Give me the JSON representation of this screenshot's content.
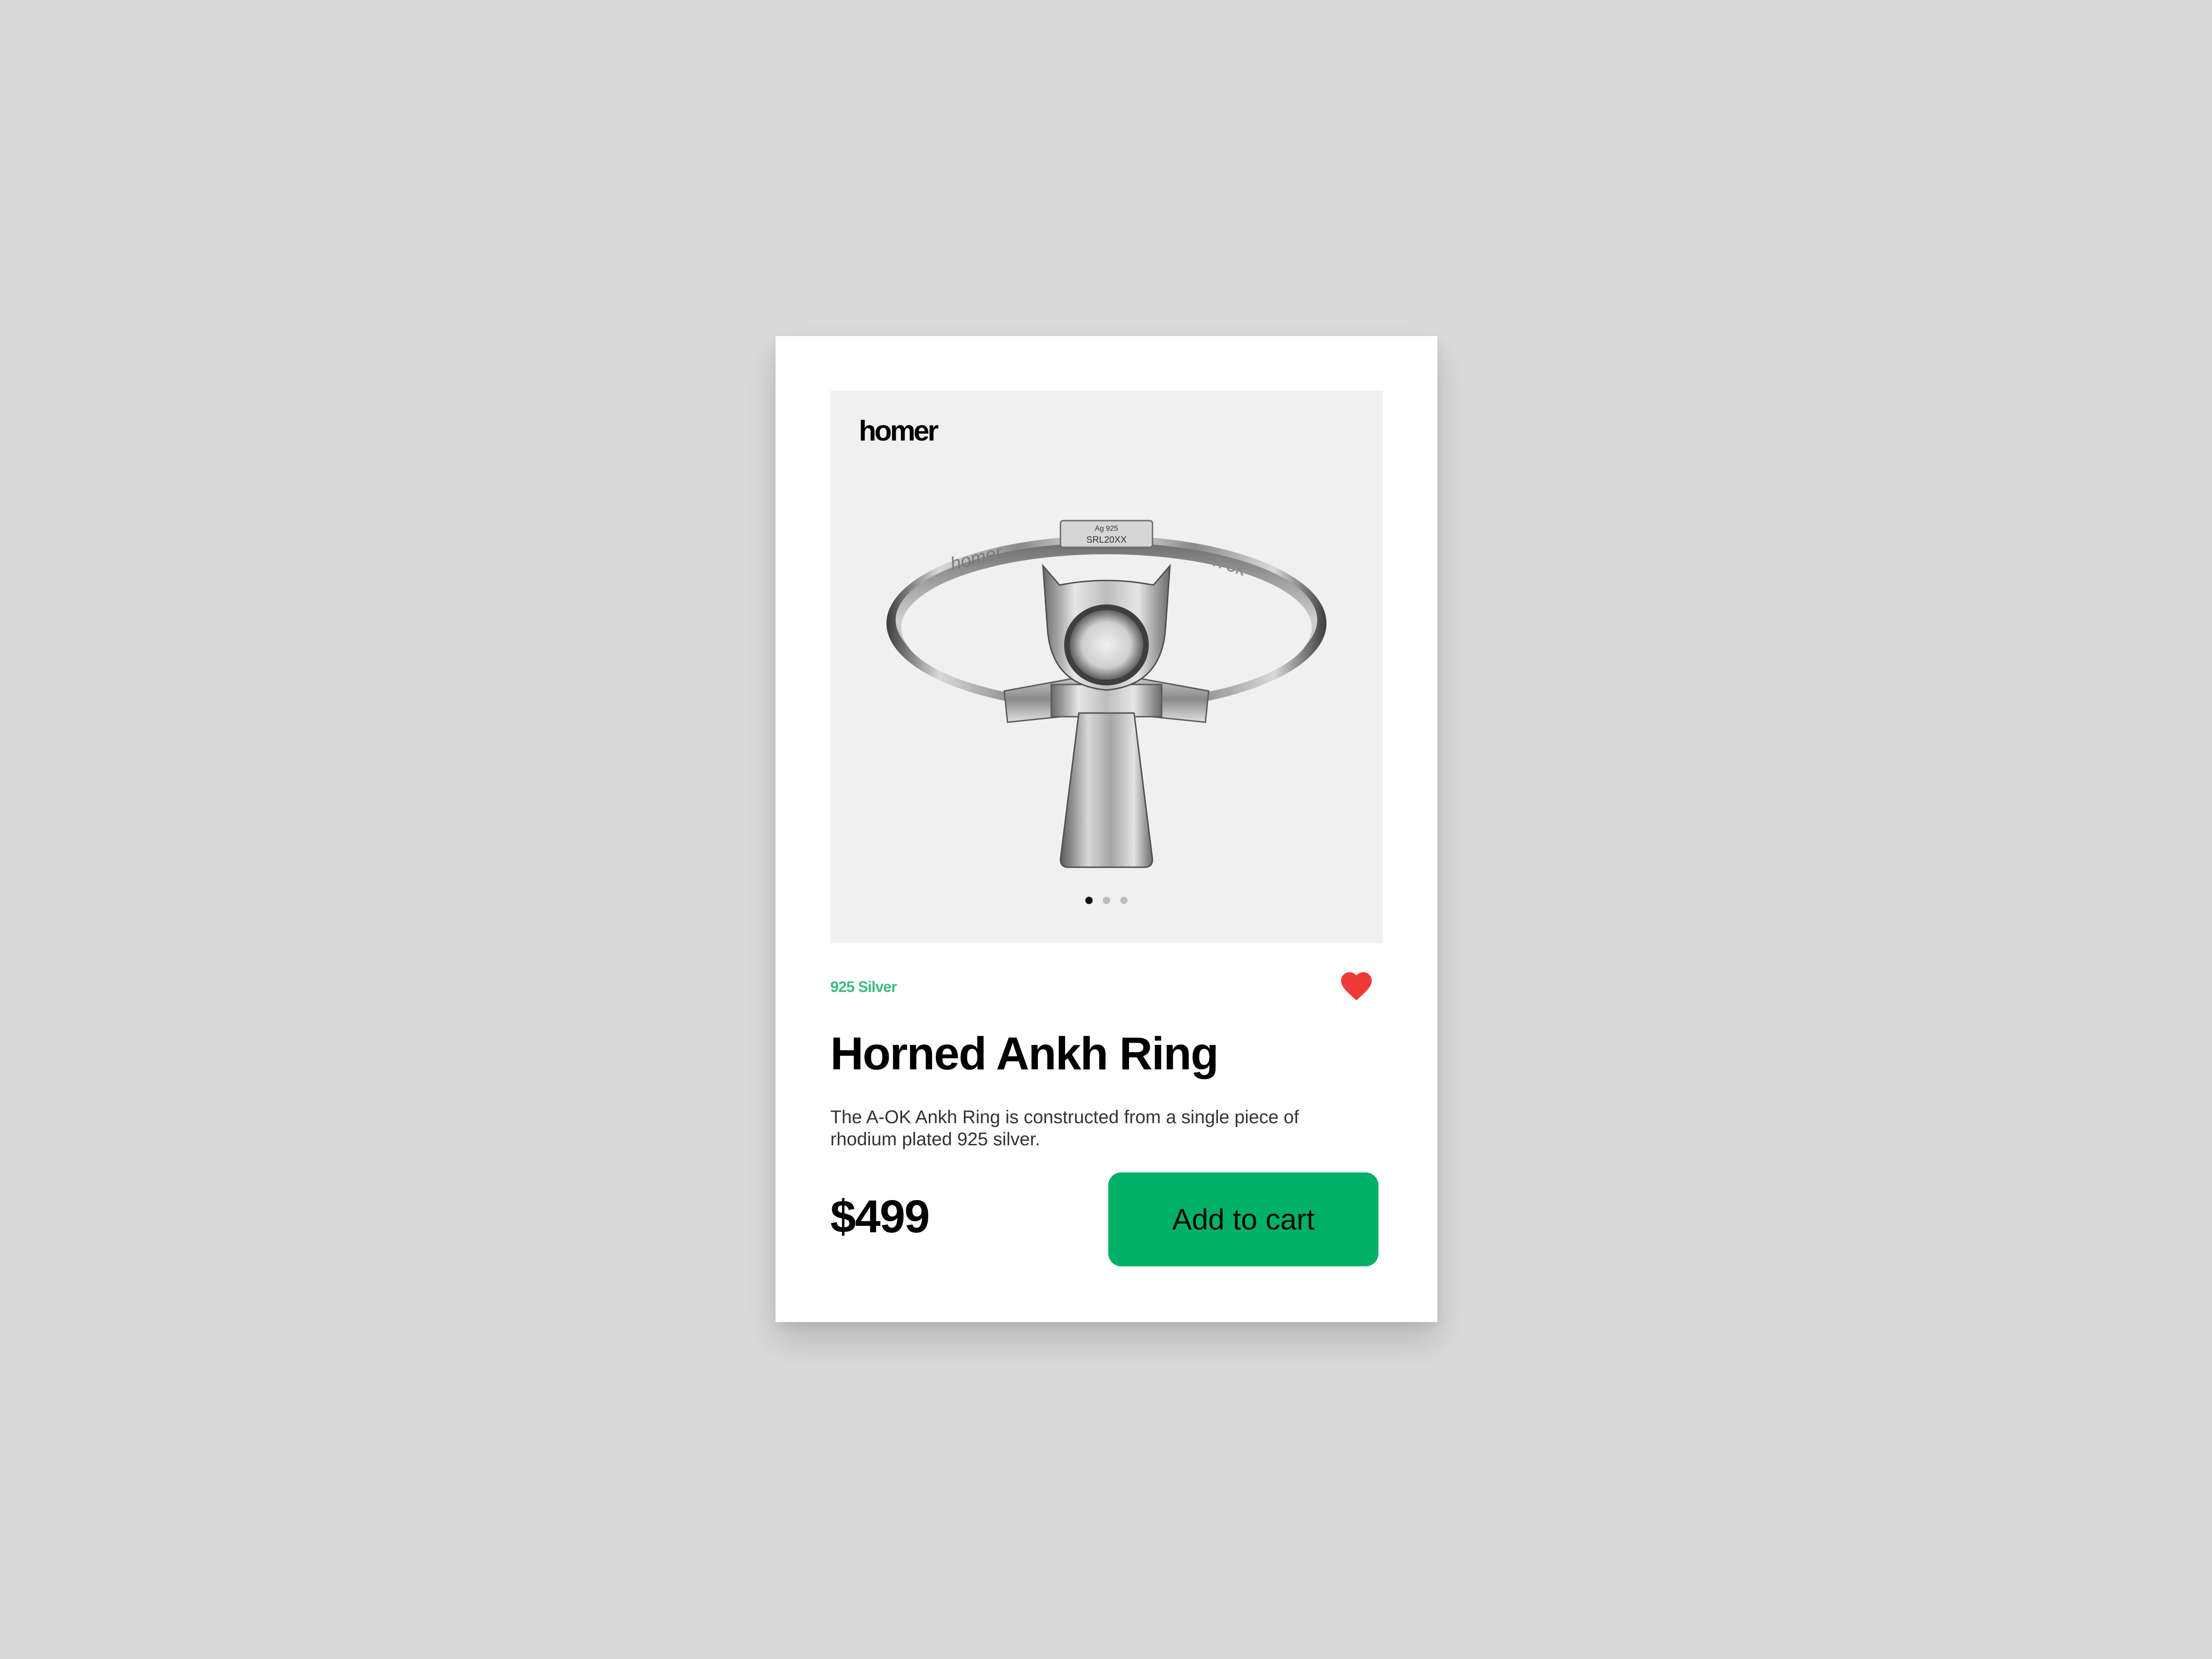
{
  "product": {
    "brand": "homer",
    "material": "925 Silver",
    "title": "Horned Ankh Ring",
    "description": "The A-OK Ankh Ring is constructed from a single piece of rhodium plated 925 silver.",
    "price": "$499",
    "add_to_cart_label": "Add to cart",
    "favorited": true
  },
  "ring_engravings": {
    "hallmark_line1": "Ag 925",
    "hallmark_line2": "SRL20XX",
    "brand_mark": "homer",
    "model_mark": "A-OK"
  },
  "carousel": {
    "slides": [
      {
        "active": true
      },
      {
        "active": false
      },
      {
        "active": false
      }
    ]
  },
  "colors": {
    "background": "#dadada",
    "card": "#ffffff",
    "image_bg": "#f0f0f0",
    "accent_green": "#00b067",
    "material_green": "#3dbb83",
    "heart_red": "#f03a3a"
  },
  "icons": {
    "favorite": "heart-icon"
  }
}
